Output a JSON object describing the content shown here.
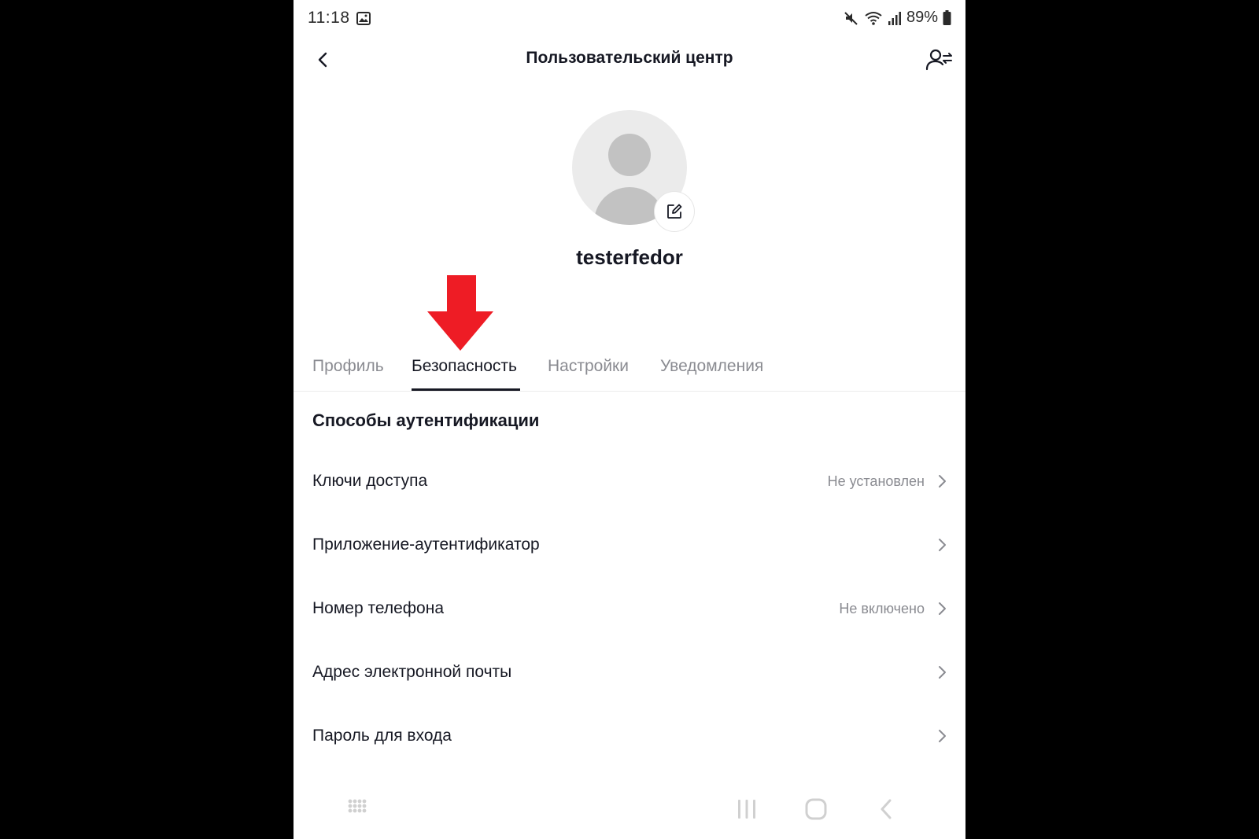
{
  "status_bar": {
    "time": "11:18",
    "battery": "89%",
    "icons": [
      "gallery-icon",
      "mute-icon",
      "wifi-icon",
      "signal-icon",
      "battery-icon"
    ]
  },
  "header": {
    "title": "Пользовательский центр",
    "back_icon": "chevron-left-icon",
    "switch_account_icon": "switch-account-icon"
  },
  "profile": {
    "username": "testerfedor",
    "edit_icon": "edit-icon"
  },
  "tabs": [
    {
      "label": "Профиль",
      "active": false
    },
    {
      "label": "Безопасность",
      "active": true
    },
    {
      "label": "Настройки",
      "active": false
    },
    {
      "label": "Уведомления",
      "active": false
    }
  ],
  "section": {
    "title": "Способы аутентификации"
  },
  "rows": [
    {
      "label": "Ключи доступа",
      "status": "Не установлен"
    },
    {
      "label": "Приложение-аутентификатор",
      "status": ""
    },
    {
      "label": "Номер телефона",
      "status": "Не включено"
    },
    {
      "label": "Адрес электронной почты",
      "status": ""
    },
    {
      "label": "Пароль для входа",
      "status": ""
    }
  ],
  "annotation": {
    "arrow_color": "#ee1c25"
  },
  "colors": {
    "text_primary": "#161823",
    "text_secondary": "#8a8b91",
    "background": "#ffffff"
  }
}
